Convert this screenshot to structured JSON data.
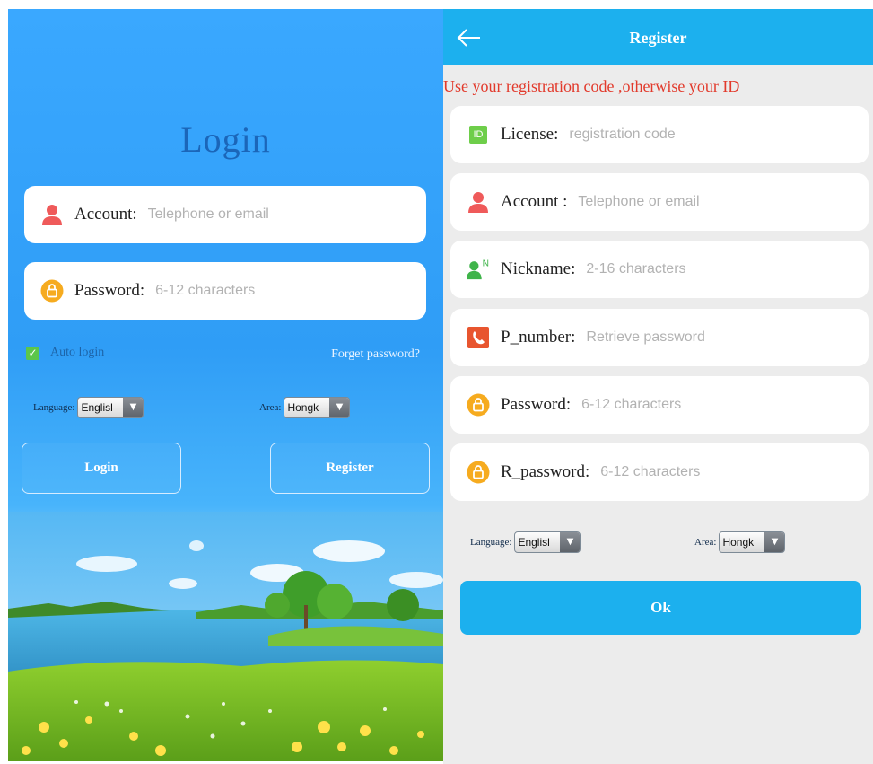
{
  "login": {
    "title": "Login",
    "account": {
      "label": "Account:",
      "placeholder": "Telephone or email"
    },
    "password": {
      "label": "Password:",
      "placeholder": "6-12 characters"
    },
    "auto_login": {
      "label": "Auto login",
      "checked": true
    },
    "forget_password": "Forget password?",
    "language": {
      "label": "Language:",
      "value": "Englisl"
    },
    "area": {
      "label": "Area:",
      "value": "Hongk"
    },
    "login_button": "Login",
    "register_button": "Register"
  },
  "register": {
    "title": "Register",
    "notice": "Use your registration code ,otherwise your ID",
    "fields": [
      {
        "icon": "id-badge-icon",
        "icon_text": "ID",
        "label": "License:",
        "placeholder": "registration code"
      },
      {
        "icon": "person-icon",
        "label": "Account :",
        "placeholder": "Telephone or email"
      },
      {
        "icon": "nickname-person-icon",
        "icon_text": "N",
        "label": "Nickname:",
        "placeholder": "2-16 characters"
      },
      {
        "icon": "phone-icon",
        "label": "P_number:",
        "placeholder": "Retrieve password"
      },
      {
        "icon": "lock-icon",
        "label": "Password:",
        "placeholder": "6-12 characters"
      },
      {
        "icon": "lock-icon",
        "label": "R_password:",
        "placeholder": "6-12 characters"
      }
    ],
    "language": {
      "label": "Language:",
      "value": "Englisl"
    },
    "area": {
      "label": "Area:",
      "value": "Hongk"
    },
    "ok_button": "Ok"
  },
  "colors": {
    "login_bg": "#2f9df6",
    "header_blue": "#1cb0ee",
    "notice_red": "#e23a2c",
    "check_green": "#5cc64a",
    "person_red": "#ef5a5a",
    "lock_orange": "#f6ab1f"
  }
}
